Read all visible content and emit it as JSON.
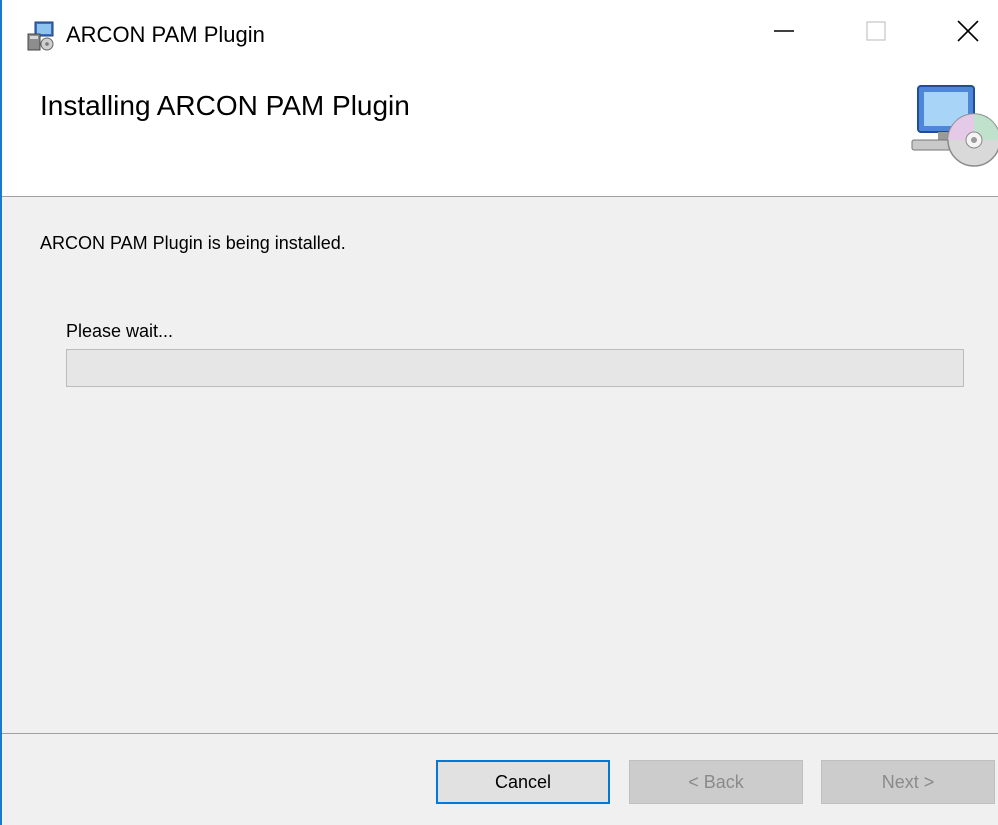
{
  "window": {
    "title": "ARCON PAM Plugin",
    "minimize_icon": "minimize-icon",
    "maximize_icon": "maximize-icon",
    "close_icon": "close-icon"
  },
  "header": {
    "title": "Installing ARCON PAM Plugin",
    "icon": "computer-disc-icon"
  },
  "body": {
    "status": "ARCON PAM Plugin is being installed.",
    "wait_label": "Please wait...",
    "progress_percent": 0
  },
  "footer": {
    "cancel_label": "Cancel",
    "back_label": "< Back",
    "next_label": "Next >"
  },
  "colors": {
    "accent": "#0078d7",
    "body_bg": "#f0f0f0",
    "progress_fill": "#06b025"
  }
}
